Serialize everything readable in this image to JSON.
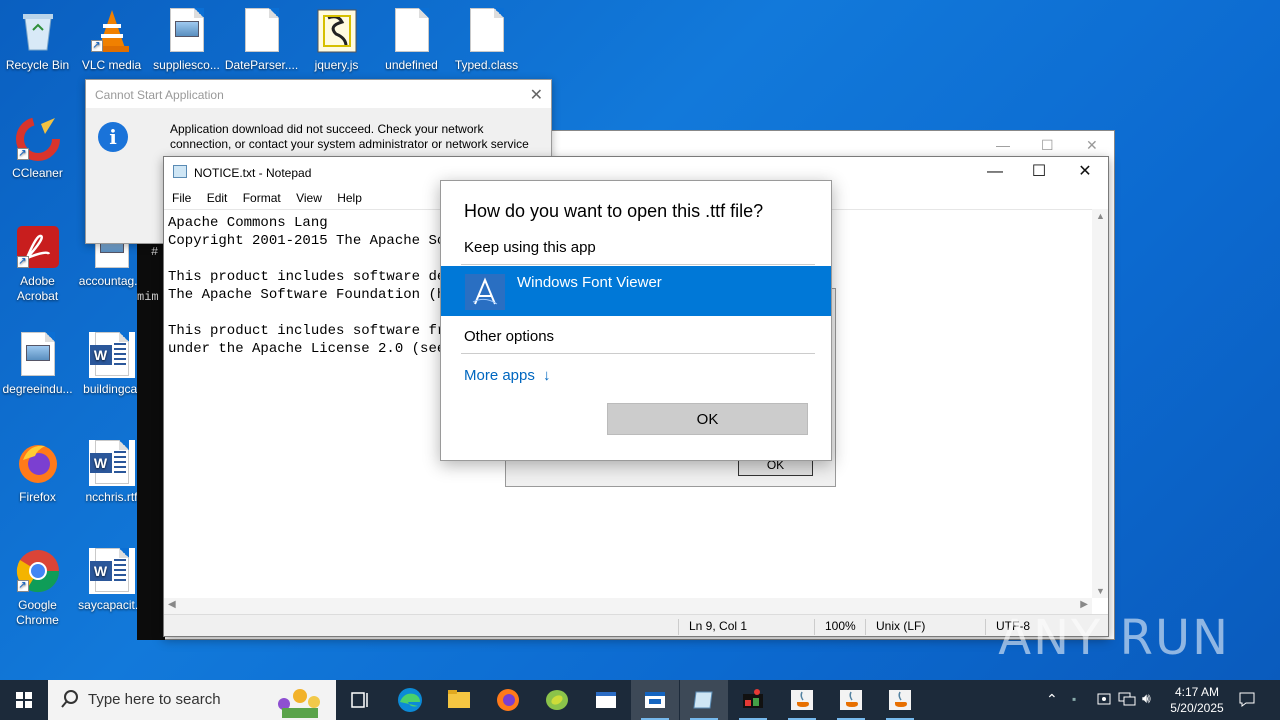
{
  "desktop_icons": [
    {
      "label": "Recycle Bin"
    },
    {
      "label": "VLC media"
    },
    {
      "label": "suppliesco..."
    },
    {
      "label": "DateParser...."
    },
    {
      "label": "jquery.js"
    },
    {
      "label": "undefined"
    },
    {
      "label": "Typed.class"
    },
    {
      "label": "CCleaner"
    },
    {
      "label": "Adobe Acrobat"
    },
    {
      "label": "accountag..."
    },
    {
      "label": "degreeindu..."
    },
    {
      "label": "buildingcal"
    },
    {
      "label": "Firefox"
    },
    {
      "label": "ncchris.rtf"
    },
    {
      "label": "Google Chrome"
    },
    {
      "label": "saycapacit..."
    }
  ],
  "error_dialog": {
    "title": "Cannot Start Application",
    "message": "Application download did not succeed. Check your network connection, or contact your system administrator or network service"
  },
  "notepad": {
    "title": "NOTICE.txt - Notepad",
    "menu": [
      "File",
      "Edit",
      "Format",
      "View",
      "Help"
    ],
    "content": "Apache Commons Lang\nCopyright 2001-2015 The Apache Sof\n\nThis product includes software dev\nThe Apache Software Foundation (ht\n\nThis product includes software fro\nunder the Apache License 2.0 (see:",
    "status": {
      "position": "Ln 9, Col 1",
      "zoom": "100%",
      "line_ending": "Unix (LF)",
      "encoding": "UTF-8"
    }
  },
  "behind_dialog": {
    "ok_label": "OK"
  },
  "console_fragment": "mim",
  "open_with": {
    "title": "How do you want to open this .ttf file?",
    "keep_using": "Keep using this app",
    "selected_app": "Windows Font Viewer",
    "other_options": "Other options",
    "more_apps": "More apps",
    "ok_label": "OK"
  },
  "watermark": "ANY RUN",
  "taskbar": {
    "search_placeholder": "Type here to search",
    "time": "4:17 AM",
    "date": "5/20/2025"
  }
}
